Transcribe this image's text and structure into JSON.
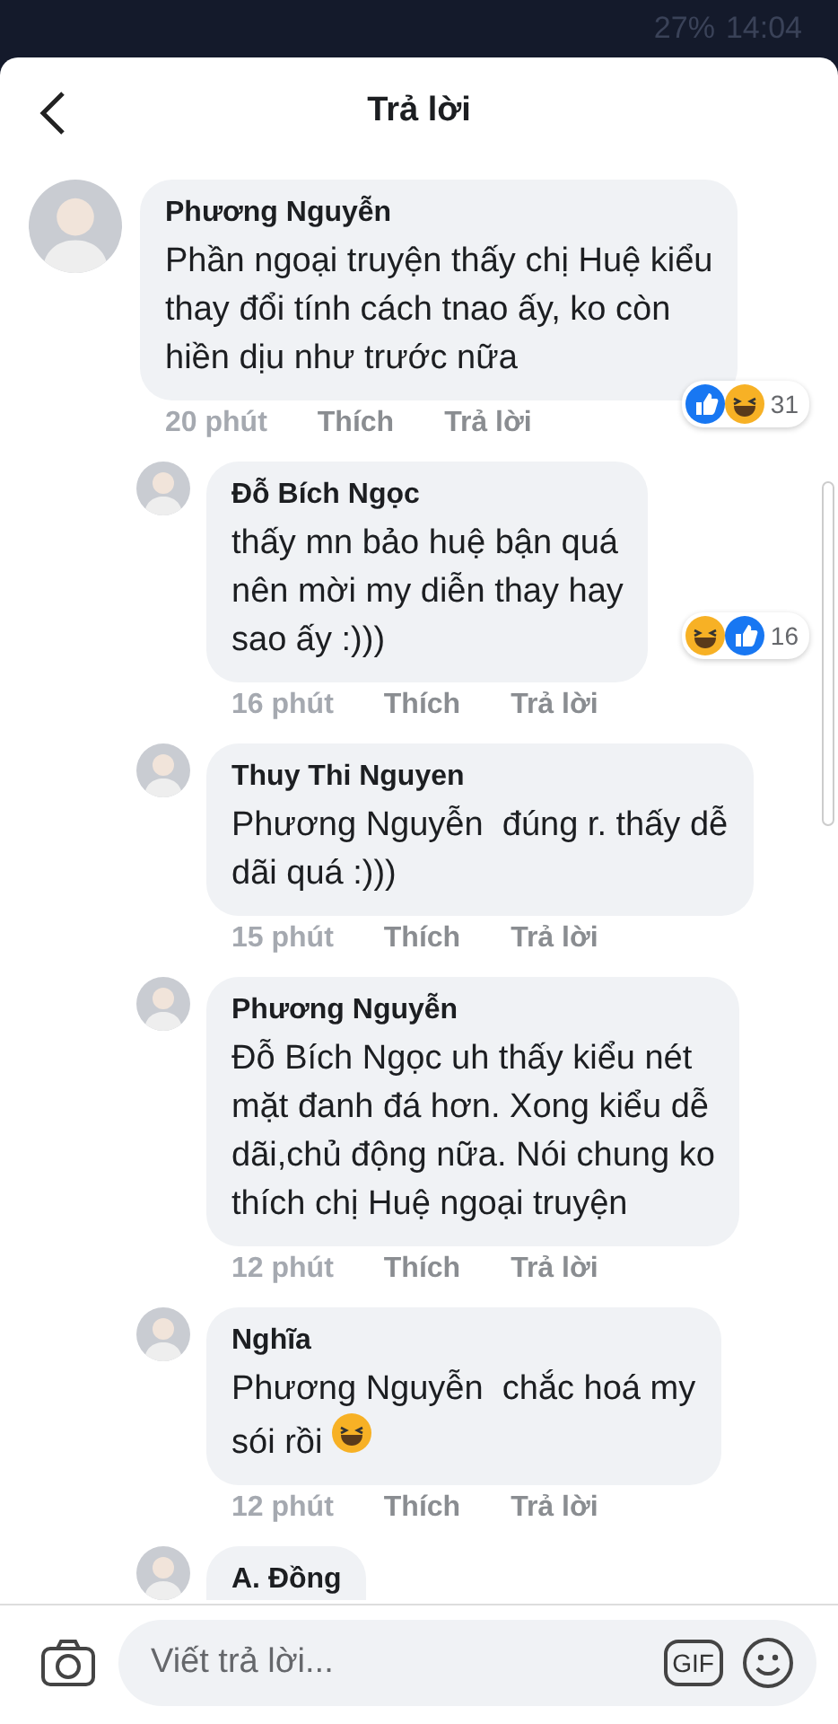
{
  "status_bar": {
    "battery": "27%",
    "time": "14:04"
  },
  "header": {
    "title": "Trả lời"
  },
  "comments": [
    {
      "name": "Phương Nguyễn",
      "text": "Phần ngoại truyện thấy chị Huệ kiểu\nthay đổi tính cách tnao ấy, ko còn\nhiền dịu như trước nữa",
      "time": "20 phút",
      "like": "Thích",
      "reply": "Trả lời",
      "reactions": [
        {
          "kind": "like"
        },
        {
          "kind": "haha"
        }
      ],
      "reaction_count": "31",
      "children": [
        {
          "name": "Đỗ Bích Ngọc",
          "text": "thấy mn bảo huệ bận quá\nnên mời my diễn thay hay\nsao ấy :)))",
          "time": "16 phút",
          "like": "Thích",
          "reply": "Trả lời",
          "reactions": [
            {
              "kind": "haha"
            },
            {
              "kind": "like"
            }
          ],
          "reaction_count": "16"
        },
        {
          "name": "Thuy Thi Nguyen",
          "text": "Phương Nguyễn  đúng r. thấy dễ\ndãi quá :)))",
          "time": "15 phút",
          "like": "Thích",
          "reply": "Trả lời"
        },
        {
          "name": "Phương Nguyễn",
          "text": "Đỗ Bích Ngọc uh thấy kiểu nét\nmặt đanh đá hơn. Xong kiểu dễ\ndãi,chủ động nữa. Nói chung ko\nthích chị Huệ ngoại truyện",
          "time": "12 phút",
          "like": "Thích",
          "reply": "Trả lời"
        },
        {
          "name": "Nghĩa",
          "text": "Phương Nguyễn  chắc hoá my\nsói rồi",
          "emoji": {
            "kind": "rolling_laugh"
          },
          "time": "12 phút",
          "like": "Thích",
          "reply": "Trả lời"
        },
        {
          "name": "A. Đồng"
        }
      ]
    }
  ],
  "composer": {
    "placeholder": "Viết trả lời...",
    "gif": "GIF"
  }
}
